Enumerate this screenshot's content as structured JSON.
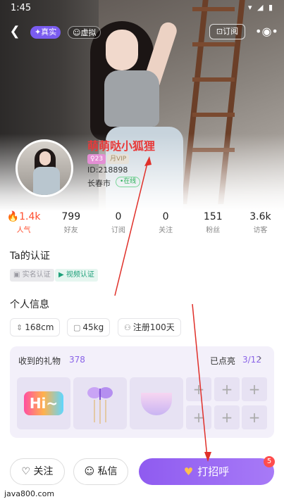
{
  "status_bar": {
    "time": "1:45",
    "icons": "▾ ◢ ▮"
  },
  "top": {
    "tag_real": "✦真实",
    "tag_virtual": "☺虚拟",
    "subscribe": "⊡订阅",
    "more": "•◉•"
  },
  "profile": {
    "name": "萌萌哒小狐狸",
    "age_badge": "♀23",
    "vip_badge": "月VIP",
    "uid": "ID:218898",
    "city": "长春市",
    "online": "•在线"
  },
  "stats": [
    {
      "num": "1.4k",
      "label": "人气",
      "icon": "flame-icon"
    },
    {
      "num": "799",
      "label": "好友"
    },
    {
      "num": "0",
      "label": "订阅"
    },
    {
      "num": "0",
      "label": "关注"
    },
    {
      "num": "151",
      "label": "粉丝"
    },
    {
      "num": "3.6k",
      "label": "访客"
    }
  ],
  "certification": {
    "title": "Ta的认证",
    "real_name": "实名认证",
    "video": "视频认证"
  },
  "personal": {
    "title": "个人信息",
    "height": "168cm",
    "weight": "45kg",
    "registered": "注册100天"
  },
  "gifts": {
    "title": "收到的礼物",
    "count": "378",
    "lit_label": "已点亮",
    "lit_num": "3/12",
    "hi_text": "Hi~"
  },
  "actions": {
    "follow": "关注",
    "message": "私信",
    "greet": "打招呼",
    "greet_badge": "5"
  },
  "watermark": "java800.com"
}
